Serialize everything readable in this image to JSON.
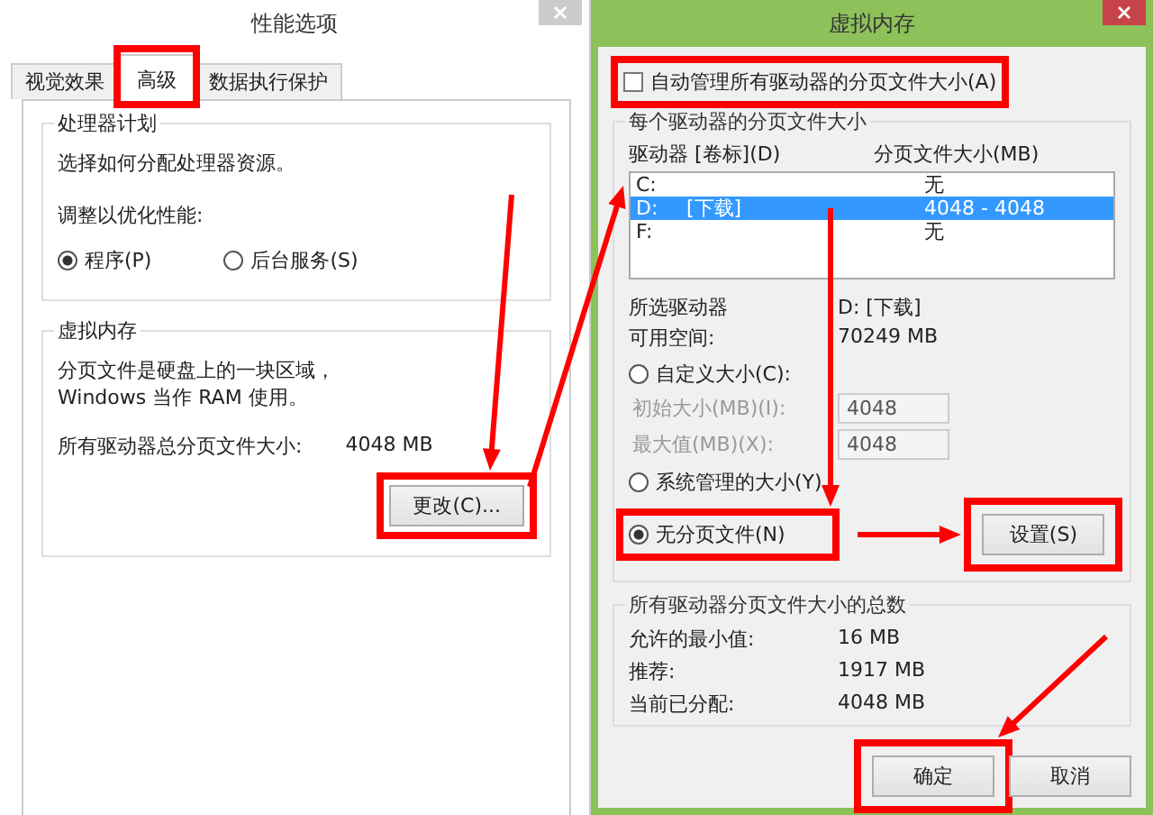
{
  "performance_window": {
    "title": "性能选项",
    "tabs": [
      {
        "label": "视觉效果",
        "selected": false
      },
      {
        "label": "高级",
        "selected": true
      },
      {
        "label": "数据执行保护",
        "selected": false
      }
    ],
    "processor_group": {
      "title": "处理器计划",
      "description": "选择如何分配处理器资源。",
      "prompt": "调整以优化性能:",
      "options": [
        {
          "label": "程序(P)",
          "selected": true
        },
        {
          "label": "后台服务(S)",
          "selected": false
        }
      ]
    },
    "virtual_memory_group": {
      "title": "虚拟内存",
      "description": "分页文件是硬盘上的一块区域，Windows 当作 RAM 使用。",
      "total_label": "所有驱动器总分页文件大小:",
      "total_value": "4048 MB",
      "button": "更改(C)..."
    }
  },
  "virtual_memory_window": {
    "title": "虚拟内存",
    "auto_manage": {
      "label": "自动管理所有驱动器的分页文件大小(A)",
      "checked": false
    },
    "drives_group": {
      "title": "每个驱动器的分页文件大小",
      "columns": [
        "驱动器 [卷标](D)",
        "分页文件大小(MB)"
      ],
      "rows": [
        {
          "drive": "C:",
          "size": "无",
          "selected": false
        },
        {
          "drive": "D:",
          "label": "[下载]",
          "size": "4048 - 4048",
          "selected": true
        },
        {
          "drive": "F:",
          "size": "无",
          "selected": false
        }
      ],
      "selected_drive_label": "所选驱动器",
      "selected_drive_value": "D:  [下载]",
      "free_space_label": "可用空间:",
      "free_space_value": "70249 MB",
      "size_options": [
        {
          "label": "自定义大小(C):",
          "selected": false
        },
        {
          "label": "系统管理的大小(Y)",
          "selected": false
        },
        {
          "label": "无分页文件(N)",
          "selected": true
        }
      ],
      "fields": [
        {
          "label": "初始大小(MB)(I):",
          "value": "4048",
          "disabled": true
        },
        {
          "label": "最大值(MB)(X):",
          "value": "4048",
          "disabled": true
        }
      ],
      "set_button": "设置(S)"
    },
    "totals_group": {
      "title": "所有驱动器分页文件大小的总数",
      "rows": [
        {
          "label": "允许的最小值:",
          "value": "16 MB"
        },
        {
          "label": "推荐:",
          "value": "1917 MB"
        },
        {
          "label": "当前已分配:",
          "value": "4048 MB"
        }
      ]
    },
    "buttons": [
      "确定",
      "取消"
    ]
  }
}
